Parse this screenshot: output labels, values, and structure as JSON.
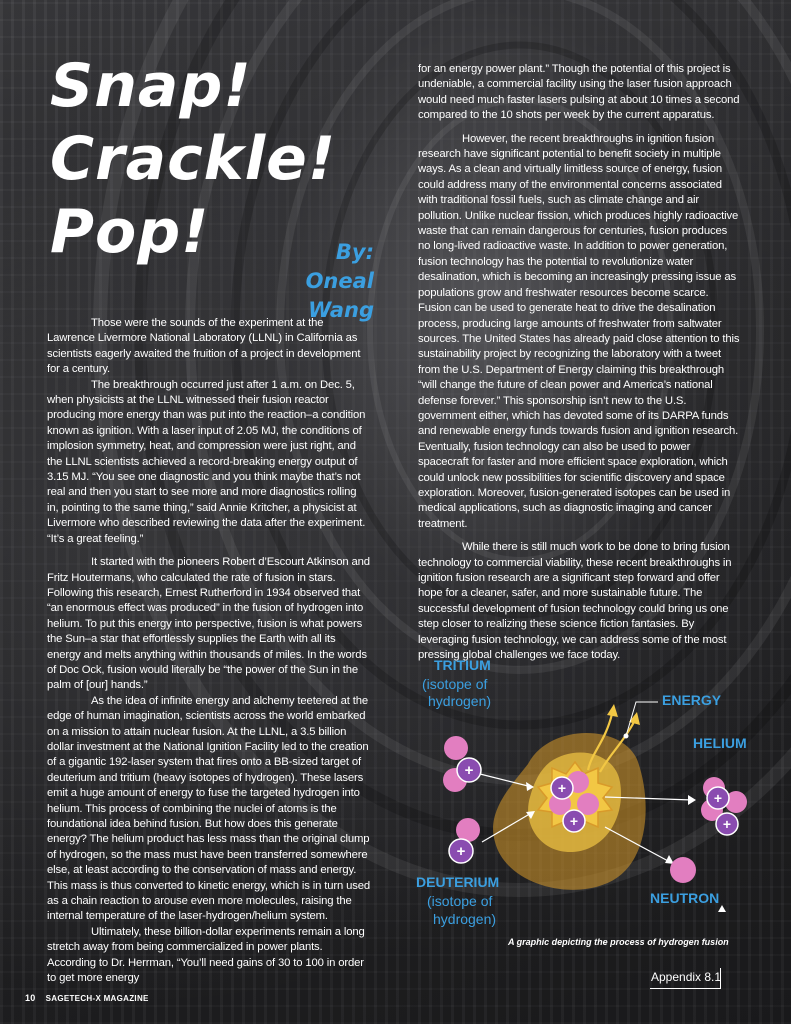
{
  "article": {
    "title_lines": [
      "Snap!",
      "Crackle!",
      "Pop!"
    ],
    "byline_lines": [
      "By: Oneal",
      "Wang"
    ],
    "left_paragraphs": [
      "Those were the sounds of the experiment at the Lawrence Livermore National Laboratory (LLNL) in California as scientists eagerly awaited the fruition of a project in development for a century.",
      "The breakthrough occurred just after 1 a.m. on Dec. 5, when physicists at the LLNL witnessed their fusion reactor producing more energy than was put into the reaction–a condition known as ignition. With a laser input of  2.05 MJ, the conditions of implosion symmetry, heat, and compression were just right, and the LLNL scientists achieved a record-breaking energy output of 3.15 MJ. “You see one diagnostic and you think maybe that’s not real and then you start to see more and more diagnostics rolling in, pointing to the same thing,” said Annie Kritcher, a physicist at Livermore who described reviewing the data after the experiment. “It’s a great feeling.”",
      "It started with the pioneers Robert d’Escourt Atkinson and Fritz Houtermans, who calculated the rate of fusion in stars. Following this research, Ernest Rutherford in 1934 observed that “an enormous effect was produced” in the fusion of hydrogen into helium. To put this energy into perspective, fusion is what powers the Sun–a star that effortlessly supplies the Earth with all its energy and melts anything within thousands of miles. In the words of Doc Ock, fusion would  literally be “the power of the Sun in the palm of [our] hands.”",
      "As the idea of infinite energy and alchemy teetered at the edge of human imagination, scientists across the world embarked on a mission to attain nuclear fusion. At the LLNL, a 3.5 billion dollar investment at the National Ignition Facility led to the creation of a gigantic 192-laser system that fires onto a BB-sized target of deuterium and tritium (heavy isotopes of hydrogen). These lasers emit a huge amount of energy to fuse the targeted hydrogen into helium. This process of combining the nuclei of atoms is the foundational idea behind fusion. But how does this generate energy? The helium product has less mass than the original clump of hydrogen, so the mass must have been transferred somewhere else, at least according to the conservation of mass and energy. This mass is thus converted to kinetic energy, which is in turn used as a chain reaction to arouse even more molecules, raising the internal temperature of the laser-hydrogen/helium system.",
      "Ultimately, these billion-dollar experiments remain a long stretch away from being commercialized in power plants. According to Dr. Herrman, “You’ll need gains of 30 to 100 in order to get more energy"
    ],
    "right_continuation": "for an energy power plant.” Though the potential of this project is undeniable, a commercial facility using the laser fusion approach would need much faster lasers pulsing at about 10 times a second compared to the 10 shots per week by the current apparatus.",
    "right_paragraphs": [
      "However, the recent breakthroughs in ignition fusion research have significant potential to benefit society in multiple ways. As a clean and virtually limitless source of energy, fusion could address many of the environmental concerns associated with traditional fossil fuels, such as climate change and air pollution. Unlike nuclear fission, which produces highly radioactive waste that can remain dangerous for centuries, fusion produces no long-lived radioactive waste. In addition to power generation, fusion technology has the potential to revolutionize water desalination, which is becoming an increasingly pressing issue as populations grow and freshwater resources become scarce. Fusion can be used to generate heat to drive the desalination process, producing large amounts of freshwater from saltwater sources. The United States has already paid close attention to this sustainability project by recognizing the laboratory with a tweet from the U.S. Department of Energy claiming this breakthrough “will change the future of clean power and America’s national defense forever.” This sponsorship isn’t new to the U.S. government either, which has devoted some of its DARPA funds and renewable energy funds towards fusion and ignition research. Eventually, fusion technology can also be used to power spacecraft for faster and more efficient space exploration, which could unlock new possibilities for scientific discovery and space exploration. Moreover, fusion-generated isotopes can be used in medical applications, such as diagnostic imaging and cancer treatment.",
      "While there is still much work to be done to bring fusion technology to commercial viability, these recent breakthroughs in ignition fusion research are a significant step forward and offer hope for a cleaner, safer, and more sustainable future. The successful development of fusion technology could bring us one step closer to realizing these science fiction fantasies. By leveraging fusion technology, we can address some of the most pressing global challenges we face today."
    ]
  },
  "diagram": {
    "tritium_label": "TRITIUM",
    "tritium_sub_1": "(isotope of",
    "tritium_sub_2": "hydrogen)",
    "energy_label": "ENERGY",
    "helium_label": "HELIUM",
    "deuterium_label": "DEUTERIUM",
    "deuterium_sub_1": "(isotope of",
    "deuterium_sub_2": "hydrogen)",
    "neutron_label": "NEUTRON",
    "caption": "A graphic depicting the process of hydrogen fusion",
    "colors": {
      "label_blue": "#3b9fe0",
      "neutron_pink": "#e27ec0",
      "proton_purple": "#8a4cb0",
      "fusion_yellow": "#f2c744",
      "fusion_orange": "#d89a2a"
    }
  },
  "footer": {
    "appendix": "Appendix 8.1",
    "page_number": "10",
    "magazine": "SAGETECH-X MAGAZINE"
  }
}
